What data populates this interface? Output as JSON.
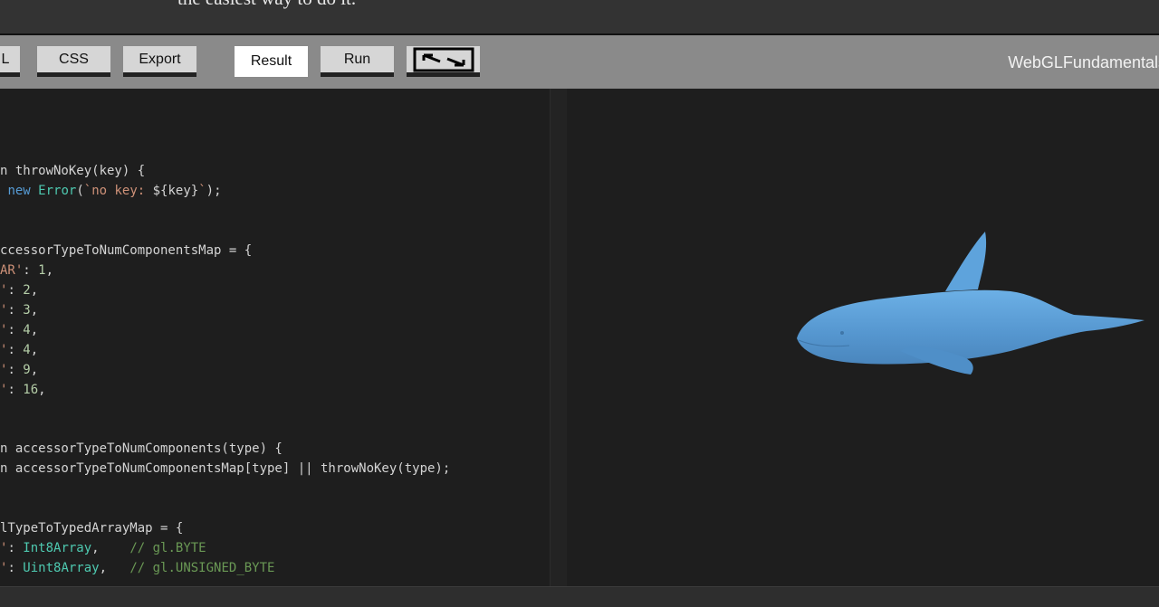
{
  "top": {
    "text": "the easiest way to do it."
  },
  "toolbar": {
    "buttons": [
      {
        "label": "L"
      },
      {
        "label": "CSS"
      },
      {
        "label": "Export"
      },
      {
        "label": "Result"
      },
      {
        "label": "Run"
      }
    ],
    "toggle_icon": "fullscreen-toggle-icon",
    "brand": "WebGLFundamentals"
  },
  "code": {
    "l1": {
      "a": "n throwNoKey(key) {"
    },
    "l2": {
      "a": " ",
      "kw": "new",
      "b": " ",
      "cls": "Error",
      "c": "(",
      "str": "`no key: ",
      "d": "${key}",
      "str2": "`",
      "e": ");"
    },
    "l3": {
      "a": "ccessorTypeToNumComponentsMap = {"
    },
    "l4": {
      "str": "AR'",
      "a": ": ",
      "num": "1",
      "b": ","
    },
    "l5": {
      "str": "'",
      "a": ": ",
      "num": "2",
      "b": ","
    },
    "l6": {
      "str": "'",
      "a": ": ",
      "num": "3",
      "b": ","
    },
    "l7": {
      "str": "'",
      "a": ": ",
      "num": "4",
      "b": ","
    },
    "l8": {
      "str": "'",
      "a": ": ",
      "num": "4",
      "b": ","
    },
    "l9": {
      "str": "'",
      "a": ": ",
      "num": "9",
      "b": ","
    },
    "l10": {
      "str": "'",
      "a": ": ",
      "num": "16",
      "b": ","
    },
    "l11": {
      "a": "n accessorTypeToNumComponents(type) {"
    },
    "l12": {
      "a": "n accessorTypeToNumComponentsMap[type] || throwNoKey(type);"
    },
    "l13": {
      "a": "lTypeToTypedArrayMap = {"
    },
    "l14": {
      "str": "'",
      "a": ": ",
      "cls": "Int8Array",
      "b": ",    ",
      "cmt": "// gl.BYTE"
    },
    "l15": {
      "str": "'",
      "a": ": ",
      "cls": "Uint8Array",
      "b": ",   ",
      "cmt": "// gl.UNSIGNED_BYTE"
    }
  },
  "colors": {
    "editor_bg": "#1e1e1e",
    "toolbar_bg": "#8a8a8a",
    "whale": "#5a9fd8"
  }
}
